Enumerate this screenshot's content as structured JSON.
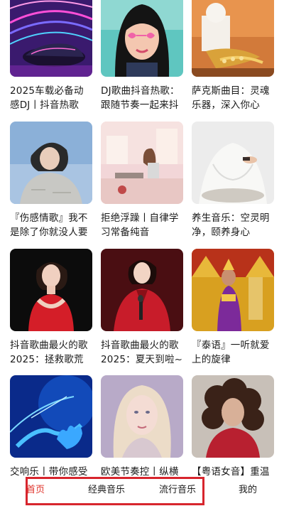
{
  "playlists": [
    {
      "title": "2025车载必备动感DJ丨抖音热歌",
      "cover": "neon-supercar-cover"
    },
    {
      "title": "DJ歌曲抖音热歌：跟随节奏一起来抖",
      "cover": "comic-girl-heart-glasses-cover"
    },
    {
      "title": "萨克斯曲目：灵魂乐器，深入你心",
      "cover": "golden-saxophone-cover"
    },
    {
      "title": "『伤感情歌』我不是除了你就没人要",
      "cover": "woman-in-sweater-cover"
    },
    {
      "title": "拒绝浮躁丨自律学习常备纯音",
      "cover": "pastel-study-desk-cover"
    },
    {
      "title": "养生音乐：空灵明净，颐养身心",
      "cover": "meditation-hands-cover"
    },
    {
      "title": "抖音歌曲最火的歌2025：拯救歌荒",
      "cover": "singer-red-dress-cover"
    },
    {
      "title": "抖音歌曲最火的歌2025：夏天到啦~",
      "cover": "singer-red-suit-microphone-cover"
    },
    {
      "title": "『泰语』一听就爱上的旋律",
      "cover": "thai-dancer-temple-cover"
    },
    {
      "title": "交响乐丨带你感受",
      "cover": "blue-conductor-hands-cover"
    },
    {
      "title": "欧美节奏控丨纵横",
      "cover": "blonde-woman-portrait-cover"
    },
    {
      "title": "【粤语女音】重温",
      "cover": "curly-hair-woman-cover"
    }
  ],
  "tabs": [
    {
      "label": "首页",
      "active": true
    },
    {
      "label": "经典音乐",
      "active": false
    },
    {
      "label": "流行音乐",
      "active": false
    },
    {
      "label": "我的",
      "active": false
    }
  ],
  "colors": {
    "accent": "#e0342c",
    "highlight_box": "#d7252d"
  }
}
